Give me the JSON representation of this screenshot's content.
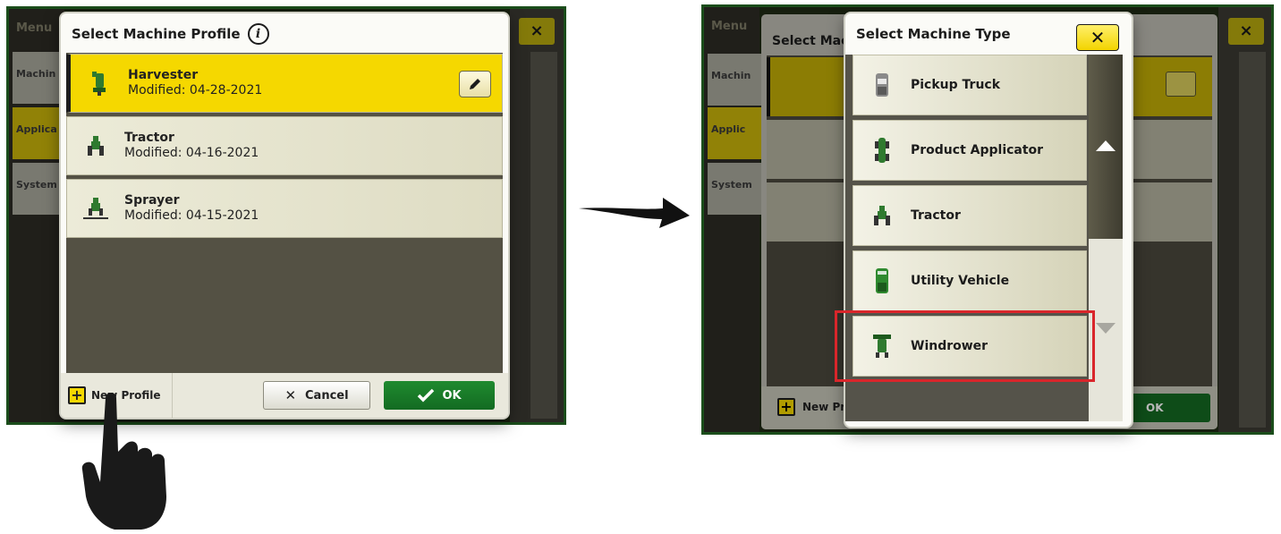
{
  "left_screen": {
    "background_menu": {
      "title": "Menu",
      "items": [
        "Machin",
        "Applica",
        "System"
      ]
    },
    "background_close": "×",
    "dialog": {
      "title": "Select Machine Profile",
      "info_icon": "i",
      "profiles": [
        {
          "name": "Harvester",
          "modified": "Modified: 04-28-2021",
          "icon": "harvester-icon",
          "selected": true
        },
        {
          "name": "Tractor",
          "modified": "Modified: 04-16-2021",
          "icon": "tractor-icon",
          "selected": false
        },
        {
          "name": "Sprayer",
          "modified": "Modified: 04-15-2021",
          "icon": "sprayer-icon",
          "selected": false
        }
      ],
      "footer": {
        "new_profile": "New Profile",
        "cancel": "Cancel",
        "ok": "OK"
      }
    }
  },
  "right_screen": {
    "background_menu": {
      "title": "Menu",
      "items": [
        "Machin",
        "Applic",
        "System"
      ]
    },
    "background_dialog": {
      "title_partial": "Select Mac",
      "new_profile_partial": "New Pr",
      "ok": "OK"
    },
    "dialog": {
      "title": "Select Machine Type",
      "close_label": "✕",
      "types": [
        {
          "name": "Pickup Truck",
          "icon": "pickup-truck-icon"
        },
        {
          "name": "Product Applicator",
          "icon": "product-applicator-icon"
        },
        {
          "name": "Tractor",
          "icon": "tractor-icon"
        },
        {
          "name": "Utility Vehicle",
          "icon": "utility-vehicle-icon"
        },
        {
          "name": "Windrower",
          "icon": "windrower-icon",
          "highlighted": true
        }
      ]
    }
  },
  "colors": {
    "john_deere_yellow": "#f5d800",
    "john_deere_green": "#1f8a2f",
    "highlight_red": "#d9262b"
  }
}
